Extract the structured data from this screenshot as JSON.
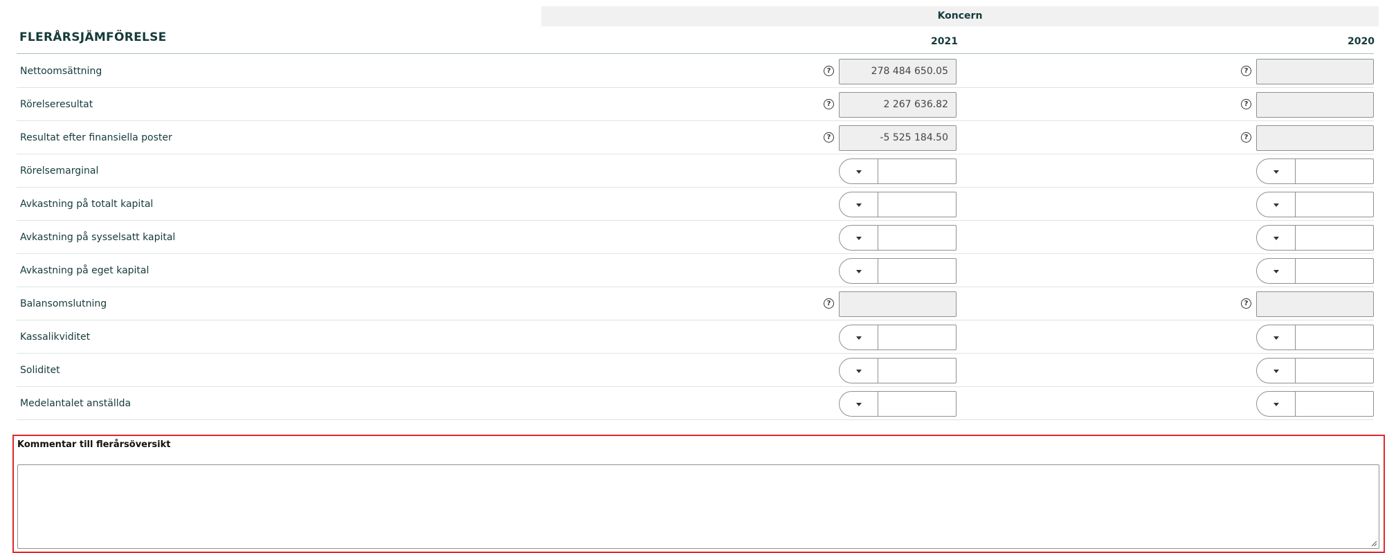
{
  "table": {
    "group_header": "Koncern",
    "section_title": "FLERÅRSJÄMFÖRELSE",
    "years": [
      "2021",
      "2020"
    ],
    "rows": [
      {
        "label": "Nettoomsättning",
        "type": "readonly",
        "values": [
          "278 484 650.05",
          ""
        ]
      },
      {
        "label": "Rörelseresultat",
        "type": "readonly",
        "values": [
          "2 267 636.82",
          ""
        ]
      },
      {
        "label": "Resultat efter finansiella poster",
        "type": "readonly",
        "values": [
          "-5 525 184.50",
          ""
        ]
      },
      {
        "label": "Rörelsemarginal",
        "type": "select-input"
      },
      {
        "label": "Avkastning på totalt kapital",
        "type": "select-input"
      },
      {
        "label": "Avkastning på sysselsatt kapital",
        "type": "select-input"
      },
      {
        "label": "Avkastning på eget kapital",
        "type": "select-input"
      },
      {
        "label": "Balansomslutning",
        "type": "readonly",
        "values": [
          "",
          ""
        ]
      },
      {
        "label": "Kassalikviditet",
        "type": "select-input"
      },
      {
        "label": "Soliditet",
        "type": "select-input"
      },
      {
        "label": "Medelantalet anställda",
        "type": "select-input"
      }
    ]
  },
  "comment": {
    "label": "Kommentar till flerårsöversikt",
    "value": ""
  },
  "colors": {
    "highlight_border": "#e0262b",
    "header_band": "#f1f1f1",
    "text": "#163a3a"
  },
  "icons": {
    "help": "question-circle-icon",
    "dropdown": "caret-down-icon"
  }
}
